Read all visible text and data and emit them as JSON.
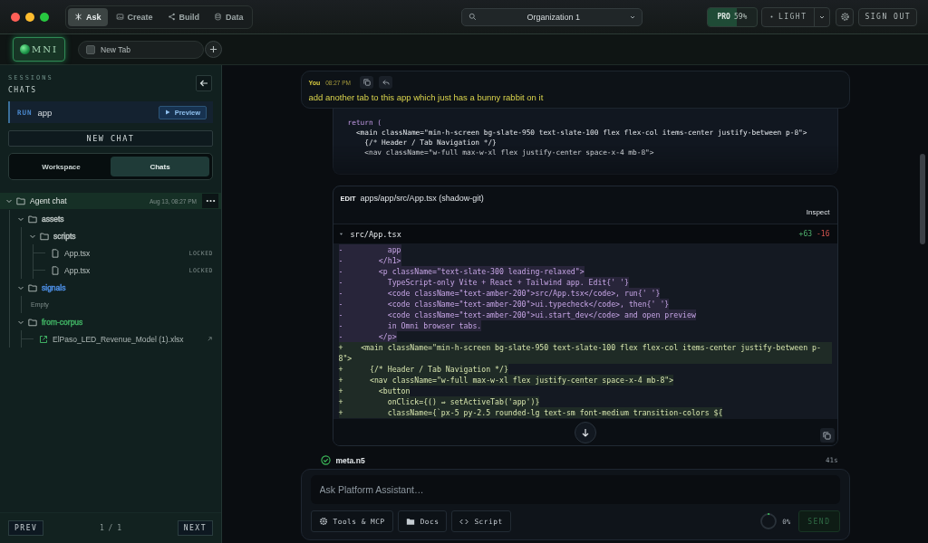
{
  "nav_tabs": [
    {
      "label": "Ask",
      "selected": true
    },
    {
      "label": "Create",
      "selected": false
    },
    {
      "label": "Build",
      "selected": false
    },
    {
      "label": "Data",
      "selected": false
    }
  ],
  "org_selector": {
    "value": "Organization 1"
  },
  "plan": {
    "label": "PRO",
    "reading": "59%",
    "level": 0.59
  },
  "theme_button": {
    "label": "LIGHT"
  },
  "sign_out": "SIGN OUT",
  "logo": {
    "text": "MNI"
  },
  "browser_tabs": [
    {
      "label": "New Tab"
    }
  ],
  "sidebar": {
    "section": "SESSIONS",
    "title": "CHATS",
    "run": {
      "tag": "RUN",
      "name": "app",
      "button": "Preview"
    },
    "new_chat": "NEW CHAT",
    "segments": [
      {
        "label": "Workspace",
        "selected": false
      },
      {
        "label": "Chats",
        "selected": true
      }
    ],
    "tree": [
      {
        "kind": "root",
        "name": "Agent chat",
        "time": "Aug 13, 08:27 PM",
        "expanded": true,
        "children": [
          {
            "kind": "folder",
            "name": "assets",
            "color": "#b9c2c0",
            "expanded": true,
            "children": [
              {
                "kind": "folder",
                "name": "scripts",
                "color": "#b9c2c0",
                "expanded": true,
                "children": [
                  {
                    "kind": "file",
                    "name": "App.tsx",
                    "badge": "LOCKED"
                  },
                  {
                    "kind": "file",
                    "name": "App.tsx",
                    "badge": "LOCKED"
                  }
                ]
              }
            ]
          },
          {
            "kind": "folder",
            "name": "signals",
            "color": "#4d8fe6",
            "expanded": true,
            "children": [
              {
                "kind": "note",
                "name": "Empty"
              }
            ]
          },
          {
            "kind": "folder",
            "name": "from-corpus",
            "color": "#3fae62",
            "expanded": true,
            "children": [
              {
                "kind": "link",
                "name": "ElPaso_LED_Revenue_Model (1).xlsx"
              }
            ]
          }
        ]
      }
    ],
    "pager": {
      "prev": "PREV",
      "page": "1 / 1",
      "next": "NEXT"
    }
  },
  "message": {
    "author": "You",
    "time": "08:27 PM",
    "text": "add another tab to this app which just has a bunny rabbit on it"
  },
  "code_preview": [
    {
      "kind": "keyword",
      "text": "return ("
    },
    {
      "kind": "plain",
      "text": "  <main className=\"min-h-screen bg-slate-950 text-slate-100 flex flex-col items-center justify-between p-8\">"
    },
    {
      "kind": "plain",
      "text": "    {/* Header / Tab Navigation */}"
    },
    {
      "kind": "plain",
      "text": "    <nav className=\"w-full max-w-xl flex justify-center space-x-4 mb-8\">"
    }
  ],
  "edit": {
    "tag": "EDIT",
    "path": "apps/app/src/App.tsx (shadow-git)",
    "action": "Inspect",
    "file": "src/App.tsx",
    "added": "+63",
    "removed": "-16",
    "lines": [
      {
        "sign": "-",
        "text": "          app"
      },
      {
        "sign": "-",
        "text": "        </h1>"
      },
      {
        "sign": "-",
        "text": "        <p className=\"text-slate-300 leading-relaxed\">"
      },
      {
        "sign": "-",
        "text": "          TypeScript-only Vite + React + Tailwind app. Edit{' '}"
      },
      {
        "sign": "-",
        "text": "          <code className=\"text-amber-200\">src/App.tsx</code>, run{' '}"
      },
      {
        "sign": "-",
        "text": "          <code className=\"text-amber-200\">ui.typecheck</code>, then{' '}"
      },
      {
        "sign": "-",
        "text": "          <code className=\"text-amber-200\">ui.start_dev</code> and open preview"
      },
      {
        "sign": "-",
        "text": "          in Omni browser tabs."
      },
      {
        "sign": "-",
        "text": "        </p>"
      },
      {
        "sign": "+",
        "text": "    <main className=\"min-h-screen bg-slate-950 text-slate-100 flex flex-col items-center justify-between p-8\">"
      },
      {
        "sign": "+",
        "text": "      {/* Header / Tab Navigation */}"
      },
      {
        "sign": "+",
        "text": "      <nav className=\"w-full max-w-xl flex justify-center space-x-4 mb-8\">"
      },
      {
        "sign": "+",
        "text": "        <button"
      },
      {
        "sign": "+",
        "text": "          onClick={() ⇒ setActiveTab('app')}"
      },
      {
        "sign": "+",
        "text": "          className={`px-5 py-2.5 rounded-lg text-sm font-medium transition-colors ${"
      }
    ]
  },
  "step": {
    "name": "meta.n5",
    "duration": "41s",
    "done": true
  },
  "composer": {
    "placeholder": "Ask Platform Assistant…",
    "tools": [
      {
        "label": "Tools & MCP"
      },
      {
        "label": "Docs"
      },
      {
        "label": "Script"
      }
    ],
    "progress": {
      "level": 0,
      "reading": "0%"
    },
    "send": {
      "label": "SEND",
      "disabled": true
    }
  }
}
